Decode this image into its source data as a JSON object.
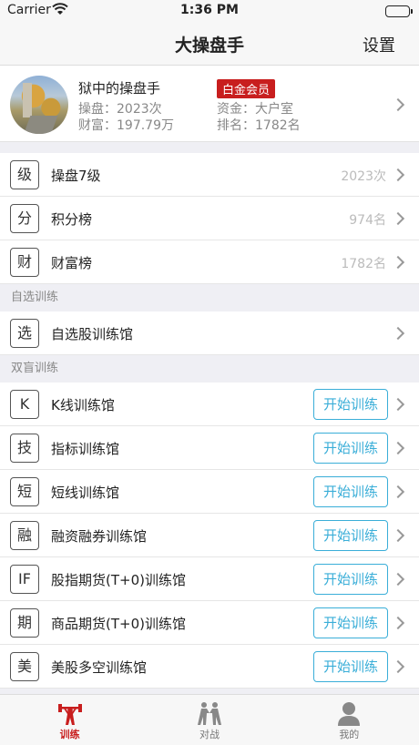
{
  "status": {
    "carrier": "Carrier",
    "time": "1:36 PM"
  },
  "nav": {
    "title": "大操盘手",
    "settings": "设置"
  },
  "profile": {
    "name": "狱中的操盘手",
    "badge": "白金会员",
    "trades": "操盘：2023次",
    "wealth": "财富：197.79万",
    "funds": "资金：大户室",
    "rank": "排名：1782名"
  },
  "stats": [
    {
      "icon": "级",
      "label": "操盘7级",
      "value": "2023次"
    },
    {
      "icon": "分",
      "label": "积分榜",
      "value": "974名"
    },
    {
      "icon": "财",
      "label": "财富榜",
      "value": "1782名"
    }
  ],
  "self_section": {
    "header": "自选训练",
    "items": [
      {
        "icon": "选",
        "label": "自选股训练馆"
      }
    ]
  },
  "blind_section": {
    "header": "双盲训练",
    "button_label": "开始训练",
    "items": [
      {
        "icon": "K",
        "label": "K线训练馆"
      },
      {
        "icon": "技",
        "label": "指标训练馆"
      },
      {
        "icon": "短",
        "label": "短线训练馆"
      },
      {
        "icon": "融",
        "label": "融资融券训练馆"
      },
      {
        "icon": "IF",
        "label": "股指期货(T+0)训练馆"
      },
      {
        "icon": "期",
        "label": "商品期货(T+0)训练馆"
      },
      {
        "icon": "美",
        "label": "美股多空训练馆"
      }
    ]
  },
  "tabs": [
    {
      "label": "训练",
      "icon": "weightlifter-icon",
      "active": true
    },
    {
      "label": "对战",
      "icon": "fight-icon",
      "active": false
    },
    {
      "label": "我的",
      "icon": "person-icon",
      "active": false
    }
  ],
  "colors": {
    "accent_red": "#c81e1e",
    "button_blue": "#3aaed8"
  }
}
